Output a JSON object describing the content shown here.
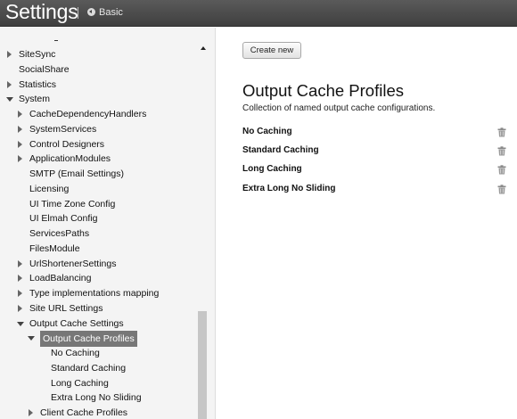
{
  "header": {
    "title": "Settings",
    "mode_label": "Basic",
    "mode_icon": "back-arrow-icon"
  },
  "sidebar": {
    "items": [
      {
        "label": "SiteSync",
        "expander": "collapsed"
      },
      {
        "label": "SocialShare",
        "expander": "none"
      },
      {
        "label": "Statistics",
        "expander": "collapsed"
      },
      {
        "label": "System",
        "expander": "expanded"
      },
      {
        "label": "CacheDependencyHandlers",
        "expander": "collapsed"
      },
      {
        "label": "SystemServices",
        "expander": "collapsed"
      },
      {
        "label": "Control Designers",
        "expander": "collapsed"
      },
      {
        "label": "ApplicationModules",
        "expander": "collapsed"
      },
      {
        "label": "SMTP (Email Settings)",
        "expander": "none"
      },
      {
        "label": "Licensing",
        "expander": "none"
      },
      {
        "label": "UI Time Zone Config",
        "expander": "none"
      },
      {
        "label": "UI Elmah Config",
        "expander": "none"
      },
      {
        "label": "ServicesPaths",
        "expander": "none"
      },
      {
        "label": "FilesModule",
        "expander": "none"
      },
      {
        "label": "UrlShortenerSettings",
        "expander": "collapsed"
      },
      {
        "label": "LoadBalancing",
        "expander": "collapsed"
      },
      {
        "label": "Type implementations mapping",
        "expander": "collapsed"
      },
      {
        "label": "Site URL Settings",
        "expander": "collapsed"
      },
      {
        "label": "Output Cache Settings",
        "expander": "expanded"
      },
      {
        "label": "Output Cache Profiles",
        "expander": "expanded",
        "selected": true
      },
      {
        "label": "No Caching",
        "expander": "none"
      },
      {
        "label": "Standard Caching",
        "expander": "none"
      },
      {
        "label": "Long Caching",
        "expander": "none"
      },
      {
        "label": "Extra Long No Sliding",
        "expander": "none"
      },
      {
        "label": "Client Cache Profiles",
        "expander": "collapsed"
      }
    ]
  },
  "main": {
    "create_button": "Create new",
    "heading": "Output Cache Profiles",
    "description": "Collection of named output cache configurations.",
    "profiles": [
      {
        "name": "No Caching",
        "icon": "trash-icon"
      },
      {
        "name": "Standard Caching",
        "icon": "trash-icon"
      },
      {
        "name": "Long Caching",
        "icon": "trash-icon"
      },
      {
        "name": "Extra Long No Sliding",
        "icon": "trash-icon"
      }
    ]
  },
  "colors": {
    "header_bg": "#4a4a4a",
    "sidebar_bg": "#f4f4f4",
    "selected_bg": "#777777"
  }
}
